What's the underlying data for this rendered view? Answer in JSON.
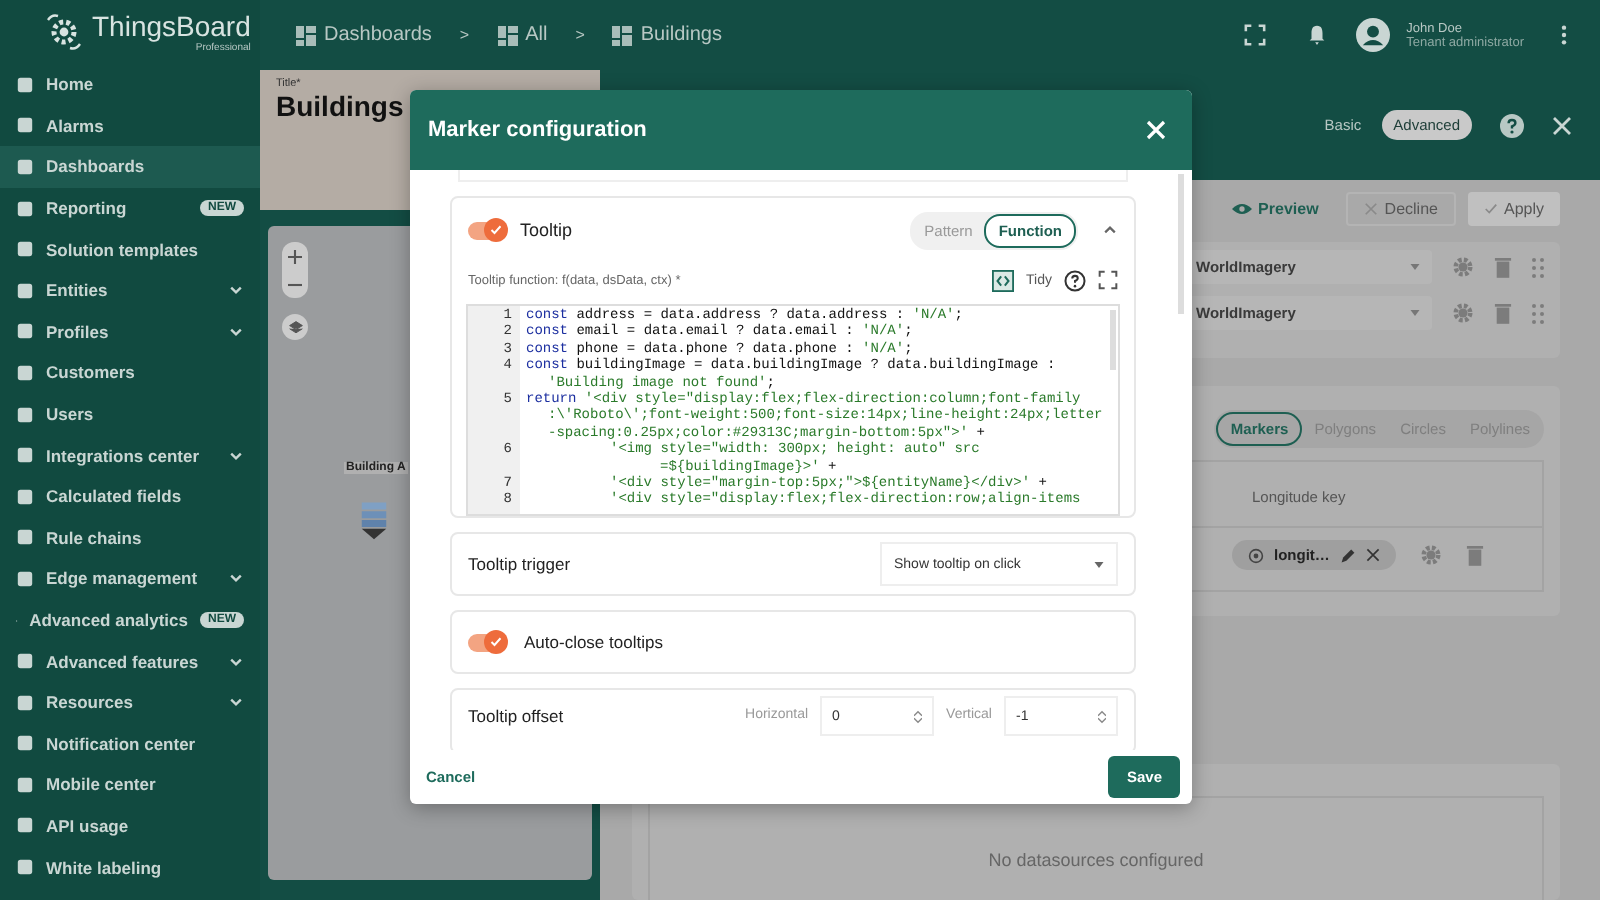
{
  "logo": {
    "name": "ThingsBoard",
    "edition": "Professional"
  },
  "sidebar": {
    "items": [
      {
        "label": "Home",
        "selected": false
      },
      {
        "label": "Alarms",
        "selected": false
      },
      {
        "label": "Dashboards",
        "selected": true
      },
      {
        "label": "Reporting",
        "selected": false,
        "badge": "NEW"
      },
      {
        "label": "Solution templates",
        "selected": false
      },
      {
        "label": "Entities",
        "selected": false,
        "expandable": true
      },
      {
        "label": "Profiles",
        "selected": false,
        "expandable": true
      },
      {
        "label": "Customers",
        "selected": false
      },
      {
        "label": "Users",
        "selected": false
      },
      {
        "label": "Integrations center",
        "selected": false,
        "expandable": true
      },
      {
        "label": "Calculated fields",
        "selected": false
      },
      {
        "label": "Rule chains",
        "selected": false
      },
      {
        "label": "Edge management",
        "selected": false,
        "expandable": true
      },
      {
        "label": "Advanced analytics",
        "selected": false,
        "badge": "NEW"
      },
      {
        "label": "Advanced features",
        "selected": false,
        "expandable": true
      },
      {
        "label": "Resources",
        "selected": false,
        "expandable": true
      },
      {
        "label": "Notification center",
        "selected": false
      },
      {
        "label": "Mobile center",
        "selected": false
      },
      {
        "label": "API usage",
        "selected": false
      },
      {
        "label": "White labeling",
        "selected": false
      }
    ]
  },
  "breadcrumbs": [
    "Dashboards",
    "All",
    "Buildings"
  ],
  "breadcrumb_separator": ">",
  "user": {
    "name": "John Doe",
    "role": "Tenant administrator"
  },
  "map_panel": {
    "title_label": "Title*",
    "title": "Buildings",
    "marker_label": "Building A"
  },
  "editor_header": {
    "modes": [
      {
        "label": "Basic",
        "selected": false
      },
      {
        "label": "Advanced",
        "selected": true
      }
    ]
  },
  "actions": [
    {
      "label": "Preview",
      "kind": "preview",
      "disabled": false
    },
    {
      "label": "Decline",
      "kind": "decline",
      "disabled": true
    },
    {
      "label": "Apply",
      "kind": "apply",
      "disabled": true
    }
  ],
  "layers": [
    {
      "value": "WorldImagery"
    },
    {
      "value": "WorldImagery"
    }
  ],
  "overlay_tabs": [
    {
      "label": "Markers",
      "selected": true
    },
    {
      "label": "Polygons",
      "selected": false
    },
    {
      "label": "Circles",
      "selected": false
    },
    {
      "label": "Polylines",
      "selected": false
    }
  ],
  "markers_table": {
    "columns": [
      "Longitude key"
    ],
    "rows": [
      {
        "chip": "longit…"
      }
    ]
  },
  "empty_datasources": "No datasources configured",
  "dialog": {
    "title": "Marker configuration",
    "tooltip": {
      "on": true,
      "label": "Tooltip",
      "expanded": true,
      "modes": [
        {
          "label": "Pattern",
          "selected": false
        },
        {
          "label": "Function",
          "selected": true
        }
      ],
      "function_label": "Tooltip function: f(data, dsData, ctx) *",
      "tidy": "Tidy",
      "code": [
        {
          "kind": "line",
          "number": "1",
          "parts": [
            {
              "kind": "keyword",
              "text": "const"
            },
            {
              "kind": "plain",
              "text": " address = data.address ? data.address : "
            },
            {
              "kind": "string",
              "text": "'N/A'"
            },
            {
              "kind": "plain",
              "text": ";"
            }
          ]
        },
        {
          "kind": "line",
          "number": "2",
          "parts": [
            {
              "kind": "keyword",
              "text": "const"
            },
            {
              "kind": "plain",
              "text": " email = data.email ? data.email : "
            },
            {
              "kind": "string",
              "text": "'N/A'"
            },
            {
              "kind": "plain",
              "text": ";"
            }
          ]
        },
        {
          "kind": "line",
          "number": "3",
          "parts": [
            {
              "kind": "keyword",
              "text": "const"
            },
            {
              "kind": "plain",
              "text": " phone = data.phone ? data.phone : "
            },
            {
              "kind": "string",
              "text": "'N/A'"
            },
            {
              "kind": "plain",
              "text": ";"
            }
          ]
        },
        {
          "kind": "line",
          "number": "4",
          "parts": [
            {
              "kind": "keyword",
              "text": "const"
            },
            {
              "kind": "plain",
              "text": " buildingImage = data.buildingImage ? data.buildingImage :"
            }
          ]
        },
        {
          "kind": "wrap",
          "parts": [
            {
              "kind": "string",
              "text": "'Building image not found'"
            },
            {
              "kind": "plain",
              "text": ";"
            }
          ]
        },
        {
          "kind": "line",
          "number": "5",
          "parts": [
            {
              "kind": "keyword",
              "text": "return"
            },
            {
              "kind": "string",
              "text": " '<div style=\"display:flex;flex-direction:column;font-family"
            }
          ]
        },
        {
          "kind": "wrap",
          "parts": [
            {
              "kind": "string",
              "text": ":\\'Roboto\\';font-weight:500;font-size:14px;line-height:24px;letter"
            }
          ]
        },
        {
          "kind": "wrap",
          "parts": [
            {
              "kind": "string",
              "text": "-spacing:0.25px;color:#29313C;margin-bottom:5px\">'"
            },
            {
              "kind": "plain",
              "text": " +"
            }
          ]
        },
        {
          "kind": "nested",
          "number": "6",
          "parts": [
            {
              "kind": "string",
              "text": "'<img style=\"width: 300px; height: auto\" src"
            }
          ]
        },
        {
          "kind": "nested_wrap",
          "parts": [
            {
              "kind": "string",
              "text": "=${buildingImage}>'"
            },
            {
              "kind": "plain",
              "text": " +"
            }
          ]
        },
        {
          "kind": "nested",
          "number": "7",
          "parts": [
            {
              "kind": "string",
              "text": "'<div style=\"margin-top:5px;\">${entityName}</div>'"
            },
            {
              "kind": "plain",
              "text": " +"
            }
          ]
        },
        {
          "kind": "nested",
          "number": "8",
          "parts": [
            {
              "kind": "string",
              "text": "'<div style=\"display:flex;flex-direction:row;align-items"
            }
          ]
        }
      ]
    },
    "trigger": {
      "label": "Tooltip trigger",
      "value": "Show tooltip on click"
    },
    "auto_close": {
      "on": true,
      "label": "Auto-close tooltips"
    },
    "offset": {
      "label": "Tooltip offset",
      "horizontal_label": "Horizontal",
      "horizontal": "0",
      "vertical_label": "Vertical",
      "vertical": "-1"
    },
    "cancel": "Cancel",
    "save": "Save"
  }
}
